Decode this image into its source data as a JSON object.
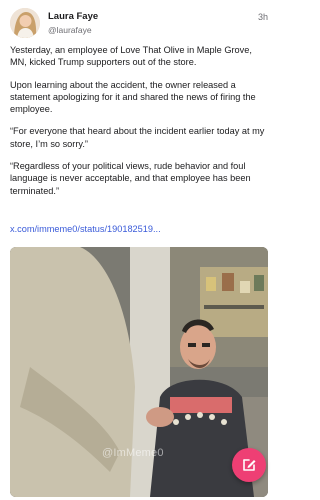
{
  "post": {
    "author": {
      "name": "Laura Faye",
      "handle": "@laurafaye"
    },
    "timestamp": "3h",
    "paragraphs": [
      "Yesterday, an employee of Love That Olive in Maple Grove, MN, kicked Trump supporters out of the store.",
      "Upon learning about the accident, the owner released a statement apologizing for it and shared the news of firing the employee.",
      "“For everyone that heard about the incident earlier today at my store, I’m so sorry.”",
      "“Regardless of your political views, rude behavior and foul language is never acceptable, and that employee has been terminated.”"
    ],
    "link_text": "x.com/immeme0/status/190182519...",
    "media": {
      "watermark": "@ImMeme0"
    }
  },
  "icons": {
    "avatar": "avatar",
    "compose": "pencil-edit-icon"
  },
  "colors": {
    "accent": "#ee3f74",
    "link": "#3a5bd9"
  }
}
